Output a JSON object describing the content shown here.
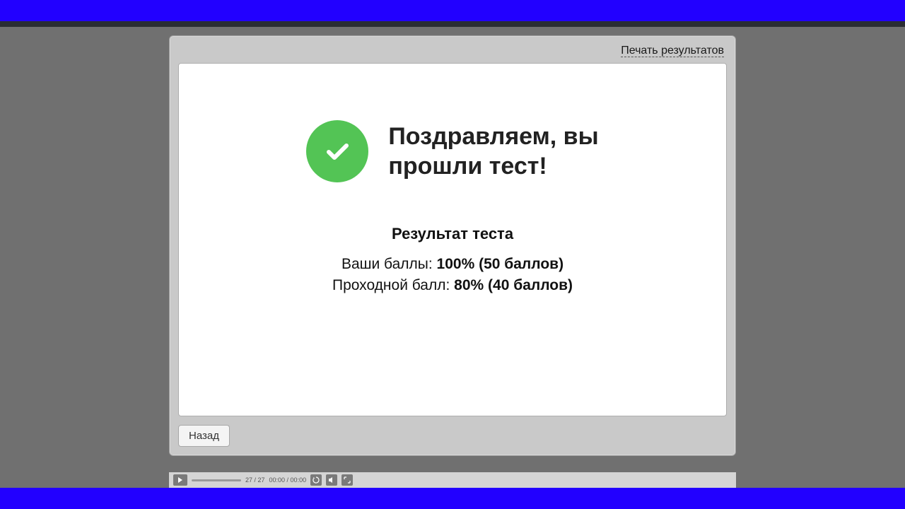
{
  "header": {
    "print_link": "Печать результатов"
  },
  "hero": {
    "title_line1": "Поздравляем, вы",
    "title_line2": "прошли тест!"
  },
  "result": {
    "heading": "Результат теста",
    "your_score_label": "Ваши баллы:",
    "your_score_value": "100% (50 баллов)",
    "passing_label": "Проходной балл:",
    "passing_value": "80% (40 баллов)"
  },
  "footer": {
    "back_label": "Назад"
  },
  "player": {
    "page_counter": "27 / 27",
    "time": "00:00 / 00:00"
  }
}
